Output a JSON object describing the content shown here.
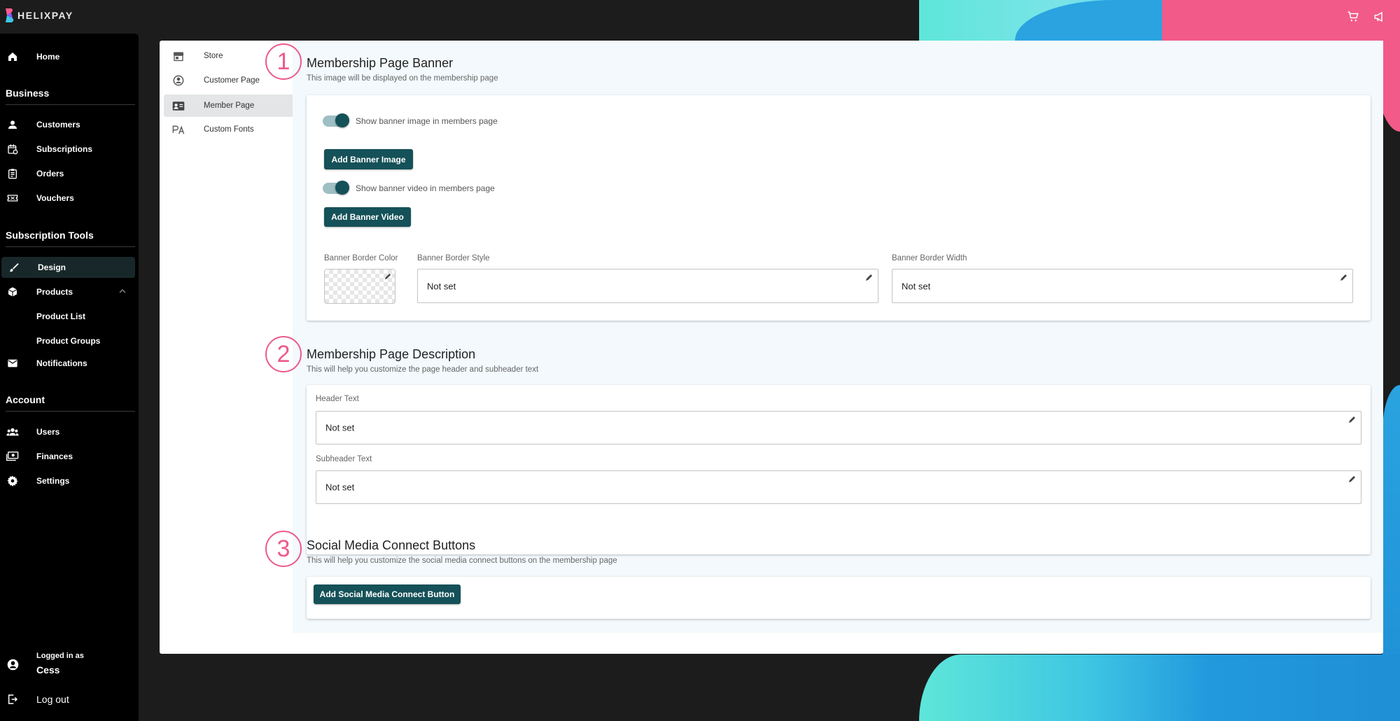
{
  "app": {
    "brand": "HELIXPAY"
  },
  "sidebar": {
    "home": "Home",
    "sections": {
      "business": "Business",
      "subscription_tools": "Subscription Tools",
      "account": "Account"
    },
    "business_items": [
      "Customers",
      "Subscriptions",
      "Orders",
      "Vouchers"
    ],
    "tools_items": {
      "design": "Design",
      "products": "Products",
      "product_list": "Product List",
      "product_groups": "Product Groups",
      "notifications": "Notifications"
    },
    "account_items": [
      "Users",
      "Finances",
      "Settings"
    ],
    "logged_in_as": "Logged in as",
    "username": "Cess",
    "logout": "Log out"
  },
  "subnav": {
    "items": [
      "Store",
      "Customer Page",
      "Member Page",
      "Custom Fonts"
    ],
    "active": "Member Page"
  },
  "annotations": [
    "1",
    "2",
    "3"
  ],
  "banner_section": {
    "title": "Membership Page Banner",
    "description": "This image will be displayed on the membership page",
    "toggle_image_label": "Show banner image in members page",
    "toggle_image_on": true,
    "add_image_button": "Add Banner Image",
    "toggle_video_label": "Show banner video in members page",
    "toggle_video_on": true,
    "add_video_button": "Add Banner Video",
    "border_color_label": "Banner Border Color",
    "border_style_label": "Banner Border Style",
    "border_style_value": "Not set",
    "border_width_label": "Banner Border Width",
    "border_width_value": "Not set"
  },
  "description_section": {
    "title": "Membership Page Description",
    "description": "This will help you customize the page header and subheader text",
    "header_label": "Header Text",
    "header_value": "Not set",
    "subheader_label": "Subheader Text",
    "subheader_value": "Not set"
  },
  "social_section": {
    "title": "Social Media Connect Buttons",
    "description": "This will help you customize the social media connect buttons on the membership page",
    "add_button": "Add Social Media Connect Button"
  },
  "colors": {
    "accent": "#155158",
    "annotation": "#ec5a8c",
    "sidebar_bg": "#000000",
    "content_bg": "#f3f9fd"
  }
}
